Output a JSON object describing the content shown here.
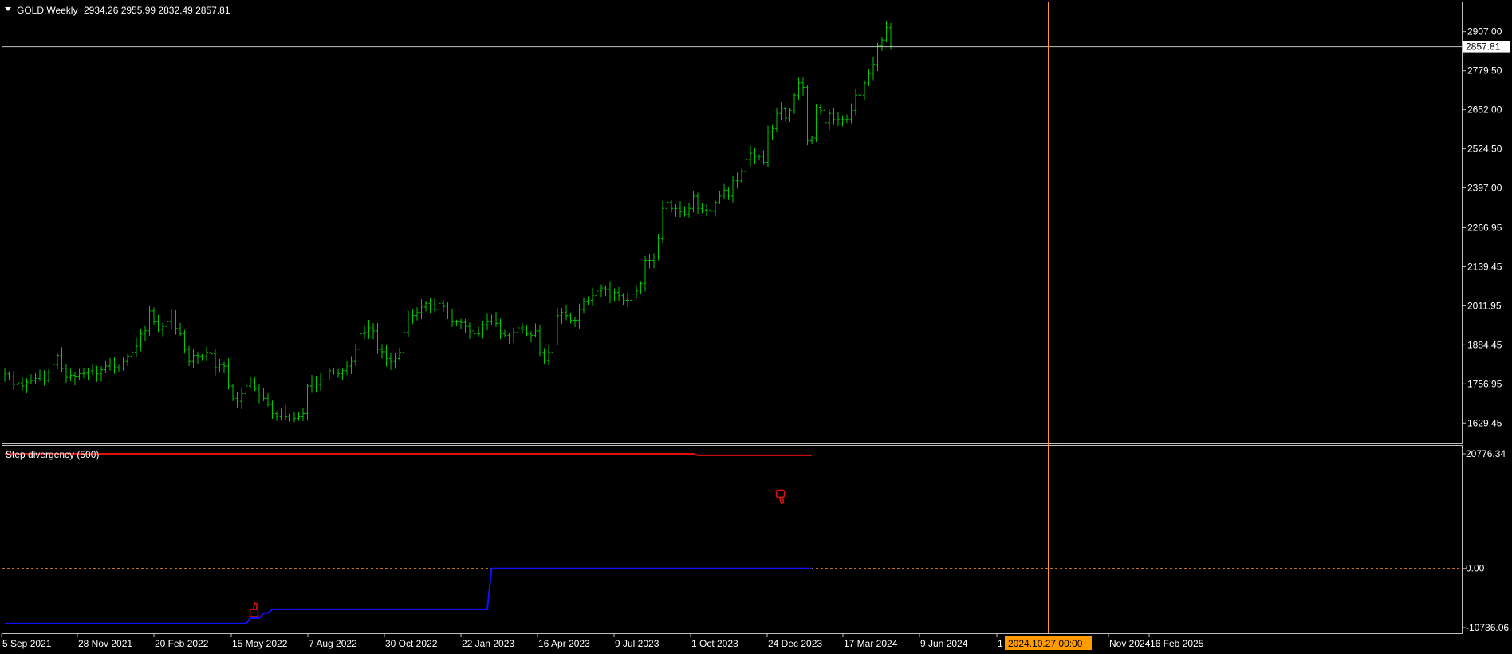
{
  "header": {
    "symbol_label": "GOLD,Weekly",
    "ohlc_label": "2934.26 2955.99 2832.49 2857.81"
  },
  "colors": {
    "background": "#000000",
    "candle": "#00c800",
    "grid_border": "#c0c0c0",
    "crosshair": "#ff9a2e",
    "bid_line": "#c0c0c0",
    "divergence_red": "#e01010",
    "divergence_blue": "#1010ff",
    "zero_line": "#ff9a2e",
    "time_highlight_bg": "#ff9a00"
  },
  "icons": {
    "dropdown": "triangle-down-icon",
    "bullish_signal": "thumbs-up-icon",
    "bearish_signal": "thumbs-down-icon"
  },
  "chart_data": [
    {
      "type": "ohlc",
      "title": "GOLD,Weekly",
      "current_price": "2857.81",
      "ylim": [
        1565,
        3000
      ],
      "y_ticks": [
        "2907.00",
        "2779.50",
        "2652.00",
        "2524.50",
        "2397.00",
        "2266.95",
        "2139.45",
        "2011.95",
        "1884.45",
        "1756.95",
        "1629.45"
      ],
      "x_ticks": [
        "5 Sep 2021",
        "28 Nov 2021",
        "20 Feb 2022",
        "15 May 2022",
        "7 Aug 2022",
        "30 Oct 2022",
        "22 Jan 2023",
        "16 Apr 2023",
        "9 Jul 2023",
        "1 Oct 2023",
        "24 Dec 2023",
        "17 Mar 2024",
        "9 Jun 2024",
        "1",
        "Nov 2024",
        "16 Feb 2025"
      ],
      "crosshair_time": "2024.10.27 00:00",
      "x_start": "2021-08-29",
      "week_step_days": 7,
      "closes": [
        1790,
        1782,
        1755,
        1760,
        1750,
        1763,
        1768,
        1775,
        1783,
        1768,
        1795,
        1820,
        1850,
        1807,
        1778,
        1785,
        1780,
        1790,
        1792,
        1800,
        1808,
        1790,
        1803,
        1815,
        1822,
        1810,
        1808,
        1830,
        1848,
        1860,
        1880,
        1920,
        1930,
        1995,
        1960,
        1935,
        1945,
        1960,
        1975,
        1938,
        1920,
        1870,
        1830,
        1850,
        1848,
        1846,
        1860,
        1855,
        1810,
        1820,
        1815,
        1750,
        1710,
        1700,
        1725,
        1750,
        1770,
        1740,
        1718,
        1710,
        1690,
        1660,
        1650,
        1665,
        1650,
        1640,
        1645,
        1650,
        1660,
        1750,
        1770,
        1755,
        1770,
        1795,
        1800,
        1795,
        1790,
        1800,
        1815,
        1830,
        1870,
        1920,
        1925,
        1940,
        1930,
        1870,
        1862,
        1840,
        1830,
        1840,
        1860,
        1925,
        1975,
        1980,
        1990,
        2008,
        2020,
        2015,
        2000,
        2020,
        2010,
        1975,
        1960,
        1960,
        1958,
        1945,
        1930,
        1920,
        1920,
        1950,
        1960,
        1975,
        1955,
        1920,
        1915,
        1910,
        1925,
        1940,
        1935,
        1920,
        1915,
        1930,
        1860,
        1833,
        1860,
        1910,
        1980,
        1990,
        1980,
        1965,
        1965,
        2000,
        2025,
        2030,
        2045,
        2060,
        2070,
        2065,
        2040,
        2055,
        2045,
        2030,
        2030,
        2050,
        2060,
        2085,
        2160,
        2160,
        2168,
        2230,
        2330,
        2350,
        2330,
        2330,
        2320,
        2310,
        2330,
        2370,
        2330,
        2325,
        2325,
        2320,
        2350,
        2370,
        2390,
        2370,
        2420,
        2420,
        2450,
        2490,
        2510,
        2500,
        2500,
        2480,
        2580,
        2590,
        2640,
        2655,
        2625,
        2650,
        2700,
        2740,
        2725,
        2550,
        2560,
        2660,
        2650,
        2610,
        2640,
        2620,
        2620,
        2620,
        2620,
        2650,
        2700,
        2700,
        2740,
        2770,
        2800,
        2860,
        2880,
        2920,
        2860
      ]
    },
    {
      "type": "line",
      "title": "Step divergency (500)",
      "ylim": [
        -10736.06,
        20776.34
      ],
      "y_ticks": [
        "20776.34",
        "0.00",
        "-10736.06"
      ],
      "zero_line": 0,
      "series": [
        {
          "name": "Step divergency (500)",
          "color": "#e01010",
          "points": [
            [
              0,
              20776.34
            ],
            [
              157,
              20776.34
            ],
            [
              158,
              20500
            ],
            [
              184,
              20500
            ]
          ]
        },
        {
          "name": "",
          "color": "#1010ff",
          "points": [
            [
              0,
              -10000
            ],
            [
              55,
              -10000
            ],
            [
              56,
              -9000
            ],
            [
              58,
              -9000
            ],
            [
              59,
              -8100
            ],
            [
              60,
              -8100
            ],
            [
              61,
              -7400
            ],
            [
              110,
              -7400
            ],
            [
              111,
              0
            ],
            [
              184,
              0
            ]
          ]
        }
      ],
      "signals": [
        {
          "index": 57,
          "type": "bullish",
          "value": -7700
        },
        {
          "index": 177,
          "type": "bearish",
          "value": 13200
        }
      ]
    }
  ]
}
